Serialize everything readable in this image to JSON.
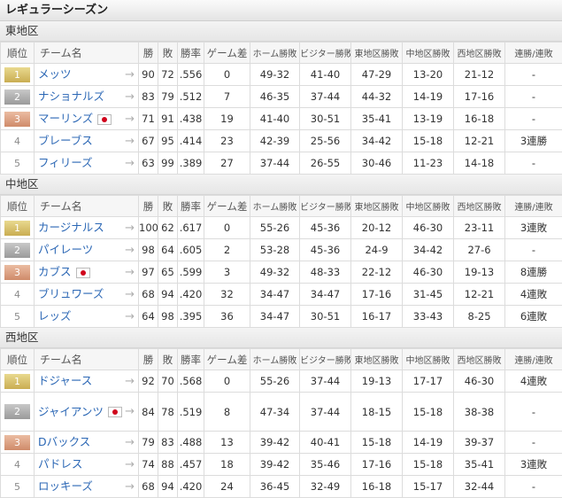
{
  "title": "レギュラーシーズン",
  "headers": {
    "rank": "順位",
    "team": "チーム名",
    "wins": "勝",
    "losses": "敗",
    "pct": "勝率",
    "gb": "ゲーム差",
    "home": "ホーム勝敗",
    "visitor": "ビジター勝敗",
    "east": "東地区勝敗",
    "central": "中地区勝敗",
    "west": "西地区勝敗",
    "streak": "連勝/連敗"
  },
  "arrow": "→",
  "divisions": [
    {
      "name": "東地区",
      "teams": [
        {
          "rank": "1",
          "name": "メッツ",
          "flag": false,
          "w": "90",
          "l": "72",
          "pct": ".556",
          "gb": "0",
          "home": "49-32",
          "visitor": "41-40",
          "east": "47-29",
          "central": "13-20",
          "west": "21-12",
          "streak": "-"
        },
        {
          "rank": "2",
          "name": "ナショナルズ",
          "flag": false,
          "w": "83",
          "l": "79",
          "pct": ".512",
          "gb": "7",
          "home": "46-35",
          "visitor": "37-44",
          "east": "44-32",
          "central": "14-19",
          "west": "17-16",
          "streak": "-"
        },
        {
          "rank": "3",
          "name": "マーリンズ",
          "flag": true,
          "w": "71",
          "l": "91",
          "pct": ".438",
          "gb": "19",
          "home": "41-40",
          "visitor": "30-51",
          "east": "35-41",
          "central": "13-19",
          "west": "16-18",
          "streak": "-"
        },
        {
          "rank": "4",
          "name": "ブレーブス",
          "flag": false,
          "w": "67",
          "l": "95",
          "pct": ".414",
          "gb": "23",
          "home": "42-39",
          "visitor": "25-56",
          "east": "34-42",
          "central": "15-18",
          "west": "12-21",
          "streak": "3連勝"
        },
        {
          "rank": "5",
          "name": "フィリーズ",
          "flag": false,
          "w": "63",
          "l": "99",
          "pct": ".389",
          "gb": "27",
          "home": "37-44",
          "visitor": "26-55",
          "east": "30-46",
          "central": "11-23",
          "west": "14-18",
          "streak": "-"
        }
      ]
    },
    {
      "name": "中地区",
      "teams": [
        {
          "rank": "1",
          "name": "カージナルス",
          "flag": false,
          "w": "100",
          "l": "62",
          "pct": ".617",
          "gb": "0",
          "home": "55-26",
          "visitor": "45-36",
          "east": "20-12",
          "central": "46-30",
          "west": "23-11",
          "streak": "3連敗"
        },
        {
          "rank": "2",
          "name": "パイレーツ",
          "flag": false,
          "w": "98",
          "l": "64",
          "pct": ".605",
          "gb": "2",
          "home": "53-28",
          "visitor": "45-36",
          "east": "24-9",
          "central": "34-42",
          "west": "27-6",
          "streak": "-"
        },
        {
          "rank": "3",
          "name": "カブス",
          "flag": true,
          "w": "97",
          "l": "65",
          "pct": ".599",
          "gb": "3",
          "home": "49-32",
          "visitor": "48-33",
          "east": "22-12",
          "central": "46-30",
          "west": "19-13",
          "streak": "8連勝"
        },
        {
          "rank": "4",
          "name": "ブリュワーズ",
          "flag": false,
          "w": "68",
          "l": "94",
          "pct": ".420",
          "gb": "32",
          "home": "34-47",
          "visitor": "34-47",
          "east": "17-16",
          "central": "31-45",
          "west": "12-21",
          "streak": "4連敗"
        },
        {
          "rank": "5",
          "name": "レッズ",
          "flag": false,
          "w": "64",
          "l": "98",
          "pct": ".395",
          "gb": "36",
          "home": "34-47",
          "visitor": "30-51",
          "east": "16-17",
          "central": "33-43",
          "west": "8-25",
          "streak": "6連敗"
        }
      ]
    },
    {
      "name": "西地区",
      "teams": [
        {
          "rank": "1",
          "name": "ドジャース",
          "flag": false,
          "w": "92",
          "l": "70",
          "pct": ".568",
          "gb": "0",
          "home": "55-26",
          "visitor": "37-44",
          "east": "19-13",
          "central": "17-17",
          "west": "46-30",
          "streak": "4連敗"
        },
        {
          "rank": "2",
          "name": "ジャイアンツ",
          "flag": true,
          "w": "84",
          "l": "78",
          "pct": ".519",
          "gb": "8",
          "home": "47-34",
          "visitor": "37-44",
          "east": "18-15",
          "central": "15-18",
          "west": "38-38",
          "streak": "-"
        },
        {
          "rank": "3",
          "name": "Dバックス",
          "flag": false,
          "w": "79",
          "l": "83",
          "pct": ".488",
          "gb": "13",
          "home": "39-42",
          "visitor": "40-41",
          "east": "15-18",
          "central": "14-19",
          "west": "39-37",
          "streak": "-"
        },
        {
          "rank": "4",
          "name": "パドレス",
          "flag": false,
          "w": "74",
          "l": "88",
          "pct": ".457",
          "gb": "18",
          "home": "39-42",
          "visitor": "35-46",
          "east": "17-16",
          "central": "15-18",
          "west": "35-41",
          "streak": "3連敗"
        },
        {
          "rank": "5",
          "name": "ロッキーズ",
          "flag": false,
          "w": "68",
          "l": "94",
          "pct": ".420",
          "gb": "24",
          "home": "36-45",
          "visitor": "32-49",
          "east": "16-18",
          "central": "15-17",
          "west": "32-44",
          "streak": "-"
        }
      ]
    }
  ]
}
